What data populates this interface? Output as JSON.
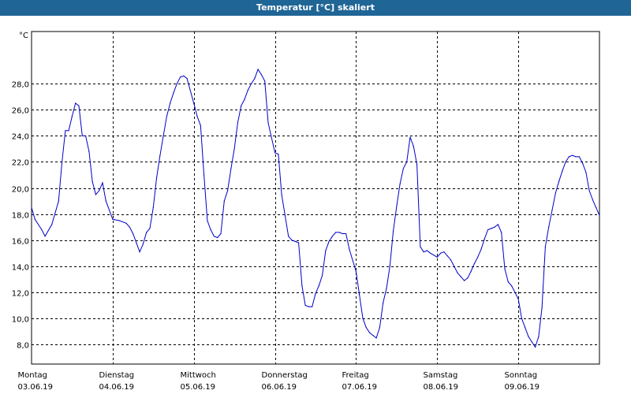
{
  "window": {
    "title": "Temperatur [°C] skaliert"
  },
  "chart_data": {
    "type": "line",
    "title": "Temperatur [°C] skaliert",
    "ylabel": "°C",
    "xlabel": "",
    "ylim": [
      6.5,
      32.0
    ],
    "xlim": [
      "2019-06-03T00:00",
      "2019-06-10T00:00"
    ],
    "yticks": [
      "8,0",
      "10,0",
      "12,0",
      "14,0",
      "16,0",
      "18,0",
      "20,0",
      "22,0",
      "24,0",
      "26,0",
      "28,0"
    ],
    "xticks": [
      {
        "day": "Montag",
        "date": "03.06.19"
      },
      {
        "day": "Dienstag",
        "date": "04.06.19"
      },
      {
        "day": "Mittwoch",
        "date": "05.06.19"
      },
      {
        "day": "Donnerstag",
        "date": "06.06.19"
      },
      {
        "day": "Freitag",
        "date": "07.06.19"
      },
      {
        "day": "Samstag",
        "date": "08.06.19"
      },
      {
        "day": "Sonntag",
        "date": "09.06.19"
      }
    ],
    "grid": true,
    "line_color": "#0000c8",
    "series": [
      {
        "x": [
          "2019-06-03T00:00",
          "2019-06-03T01:00",
          "2019-06-03T03:00",
          "2019-06-03T04:00",
          "2019-06-03T06:00",
          "2019-06-03T08:00",
          "2019-06-03T09:00",
          "2019-06-03T10:00",
          "2019-06-03T11:00",
          "2019-06-03T12:00",
          "2019-06-03T13:00",
          "2019-06-03T14:00",
          "2019-06-03T15:00",
          "2019-06-03T16:00",
          "2019-06-03T17:00",
          "2019-06-03T18:00",
          "2019-06-03T19:00",
          "2019-06-03T20:00",
          "2019-06-03T21:00",
          "2019-06-03T22:00",
          "2019-06-04T00:00",
          "2019-06-04T02:00",
          "2019-06-04T04:00",
          "2019-06-04T05:00",
          "2019-06-04T06:00",
          "2019-06-04T07:00",
          "2019-06-04T08:00",
          "2019-06-04T09:00",
          "2019-06-04T10:00",
          "2019-06-04T11:00",
          "2019-06-04T12:00",
          "2019-06-04T13:00",
          "2019-06-04T14:00",
          "2019-06-04T15:00",
          "2019-06-04T16:00",
          "2019-06-04T17:00",
          "2019-06-04T18:00",
          "2019-06-04T19:00",
          "2019-06-04T20:00",
          "2019-06-04T21:00",
          "2019-06-04T22:00",
          "2019-06-05T00:00",
          "2019-06-05T01:00",
          "2019-06-05T02:00",
          "2019-06-05T03:00",
          "2019-06-05T04:00",
          "2019-06-05T05:00",
          "2019-06-05T06:00",
          "2019-06-05T07:00",
          "2019-06-05T08:00",
          "2019-06-05T09:00",
          "2019-06-05T10:00",
          "2019-06-05T11:00",
          "2019-06-05T12:00",
          "2019-06-05T13:00",
          "2019-06-05T14:00",
          "2019-06-05T15:00",
          "2019-06-05T16:00",
          "2019-06-05T17:00",
          "2019-06-05T18:00",
          "2019-06-05T19:00",
          "2019-06-05T20:00",
          "2019-06-05T21:00",
          "2019-06-05T22:00",
          "2019-06-06T00:00",
          "2019-06-06T01:00",
          "2019-06-06T02:00",
          "2019-06-06T04:00",
          "2019-06-06T05:00",
          "2019-06-06T06:00",
          "2019-06-06T07:00",
          "2019-06-06T08:00",
          "2019-06-06T09:00",
          "2019-06-06T10:00",
          "2019-06-06T11:00",
          "2019-06-06T12:00",
          "2019-06-06T13:00",
          "2019-06-06T14:00",
          "2019-06-06T15:00",
          "2019-06-06T16:00",
          "2019-06-06T17:00",
          "2019-06-06T18:00",
          "2019-06-06T19:00",
          "2019-06-06T20:00",
          "2019-06-06T21:00",
          "2019-06-06T22:00",
          "2019-06-07T00:00",
          "2019-06-07T01:00",
          "2019-06-07T02:00",
          "2019-06-07T03:00",
          "2019-06-07T04:00",
          "2019-06-07T05:00",
          "2019-06-07T06:00",
          "2019-06-07T07:00",
          "2019-06-07T08:00",
          "2019-06-07T09:00",
          "2019-06-07T10:00",
          "2019-06-07T11:00",
          "2019-06-07T12:00",
          "2019-06-07T13:00",
          "2019-06-07T14:00",
          "2019-06-07T15:00",
          "2019-06-07T16:00",
          "2019-06-07T17:00",
          "2019-06-07T18:00",
          "2019-06-07T19:00",
          "2019-06-07T20:00",
          "2019-06-07T21:00",
          "2019-06-07T22:00",
          "2019-06-08T00:00",
          "2019-06-08T01:00",
          "2019-06-08T02:00",
          "2019-06-08T03:00",
          "2019-06-08T04:00",
          "2019-06-08T05:00",
          "2019-06-08T06:00",
          "2019-06-08T07:00",
          "2019-06-08T08:00",
          "2019-06-08T09:00",
          "2019-06-08T10:00",
          "2019-06-08T11:00",
          "2019-06-08T12:00",
          "2019-06-08T13:00",
          "2019-06-08T14:00",
          "2019-06-08T15:00",
          "2019-06-08T16:00",
          "2019-06-08T17:00",
          "2019-06-08T18:00",
          "2019-06-08T19:00",
          "2019-06-08T20:00",
          "2019-06-08T21:00",
          "2019-06-08T22:00",
          "2019-06-09T00:00",
          "2019-06-09T01:00",
          "2019-06-09T02:00",
          "2019-06-09T03:00",
          "2019-06-09T04:00",
          "2019-06-09T05:00",
          "2019-06-09T06:00",
          "2019-06-09T07:00",
          "2019-06-09T08:00",
          "2019-06-09T09:00",
          "2019-06-09T10:00",
          "2019-06-09T11:00",
          "2019-06-09T12:00",
          "2019-06-09T13:00",
          "2019-06-09T14:00",
          "2019-06-09T15:00",
          "2019-06-09T16:00",
          "2019-06-09T17:00",
          "2019-06-09T18:00",
          "2019-06-09T19:00",
          "2019-06-09T20:00",
          "2019-06-09T21:00",
          "2019-06-09T22:00",
          "2019-06-09T23:00",
          "2019-06-10T00:00"
        ],
        "y": [
          18.5,
          17.6,
          16.8,
          16.3,
          17.2,
          19.0,
          22.0,
          24.4,
          24.4,
          25.5,
          26.5,
          26.3,
          24.0,
          24.0,
          22.8,
          20.5,
          19.5,
          19.8,
          20.4,
          19.0,
          17.6,
          17.5,
          17.3,
          17.0,
          16.5,
          15.8,
          15.1,
          15.7,
          16.6,
          16.9,
          18.5,
          20.8,
          22.5,
          24.0,
          25.5,
          26.5,
          27.3,
          28.0,
          28.5,
          28.6,
          28.4,
          26.5,
          25.5,
          24.8,
          21.0,
          17.5,
          16.8,
          16.3,
          16.2,
          16.5,
          19.0,
          19.8,
          21.5,
          23.0,
          25.0,
          26.3,
          26.8,
          27.5,
          28.0,
          28.4,
          29.1,
          28.7,
          28.2,
          25.0,
          22.7,
          22.6,
          19.5,
          16.3,
          16.0,
          15.9,
          15.8,
          12.5,
          11.0,
          10.9,
          10.9,
          11.9,
          12.5,
          13.3,
          15.2,
          15.9,
          16.3,
          16.6,
          16.6,
          16.5,
          16.5,
          15.3,
          13.6,
          11.8,
          10.0,
          9.3,
          8.9,
          8.7,
          8.5,
          9.3,
          11.2,
          12.3,
          14.0,
          16.7,
          18.6,
          20.3,
          21.5,
          22.0,
          23.9,
          23.2,
          21.8,
          15.5,
          15.1,
          15.2,
          15.0,
          14.7,
          15.0,
          15.1,
          14.8,
          14.5,
          14.0,
          13.5,
          13.2,
          12.9,
          13.1,
          13.6,
          14.2,
          14.7,
          15.3,
          16.1,
          16.8,
          16.9,
          17.0,
          17.2,
          16.6,
          13.8,
          12.8,
          12.5,
          11.5,
          10.0,
          9.3,
          8.6,
          8.2,
          7.8,
          8.6,
          10.8,
          15.5,
          17.0,
          18.3,
          19.6,
          20.5,
          21.3,
          22.0,
          22.4,
          22.5,
          22.4,
          22.4,
          21.9,
          21.2,
          19.8,
          19.1,
          18.5,
          17.9
        ]
      }
    ]
  }
}
